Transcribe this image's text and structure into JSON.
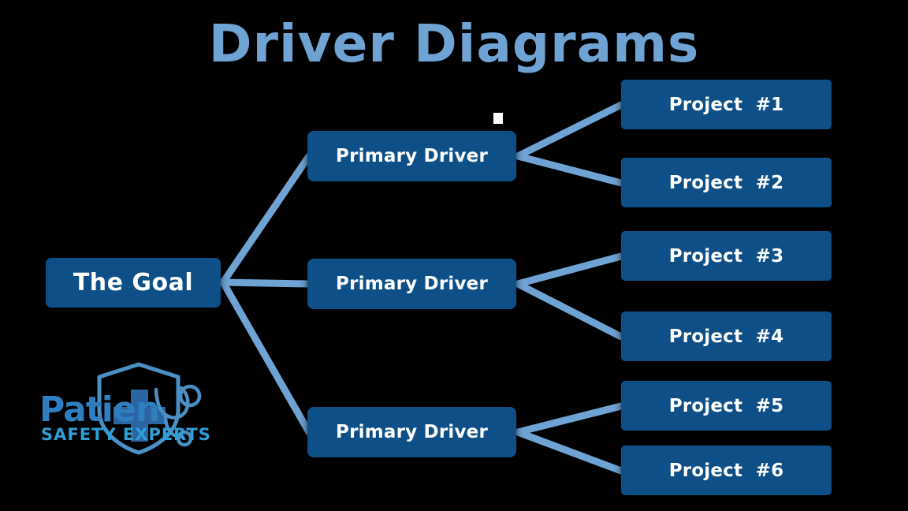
{
  "slide": {
    "title": "Driver Diagrams",
    "background_color": "#000000",
    "accent_light_blue": "#6ea3d4",
    "node_fill": "#0d4f86",
    "node_text_color": "#ffffff"
  },
  "diagram": {
    "type": "driver-diagram",
    "goal": {
      "label": "The Goal"
    },
    "primary_drivers": [
      {
        "label": "Primary Driver"
      },
      {
        "label": "Primary Driver"
      },
      {
        "label": "Primary Driver"
      }
    ],
    "projects": [
      {
        "label": "Project  #1"
      },
      {
        "label": "Project  #2"
      },
      {
        "label": "Project  #3"
      },
      {
        "label": "Project  #4"
      },
      {
        "label": "Project  #5"
      },
      {
        "label": "Project  #6"
      }
    ]
  },
  "logo": {
    "name_line1": "Patien",
    "name_cross_letter": "t",
    "name_line2": "SAFETY EXPERTS",
    "color": "#4a90c4",
    "icons": [
      "shield-icon",
      "stethoscope-icon",
      "medical-cross-icon"
    ]
  }
}
